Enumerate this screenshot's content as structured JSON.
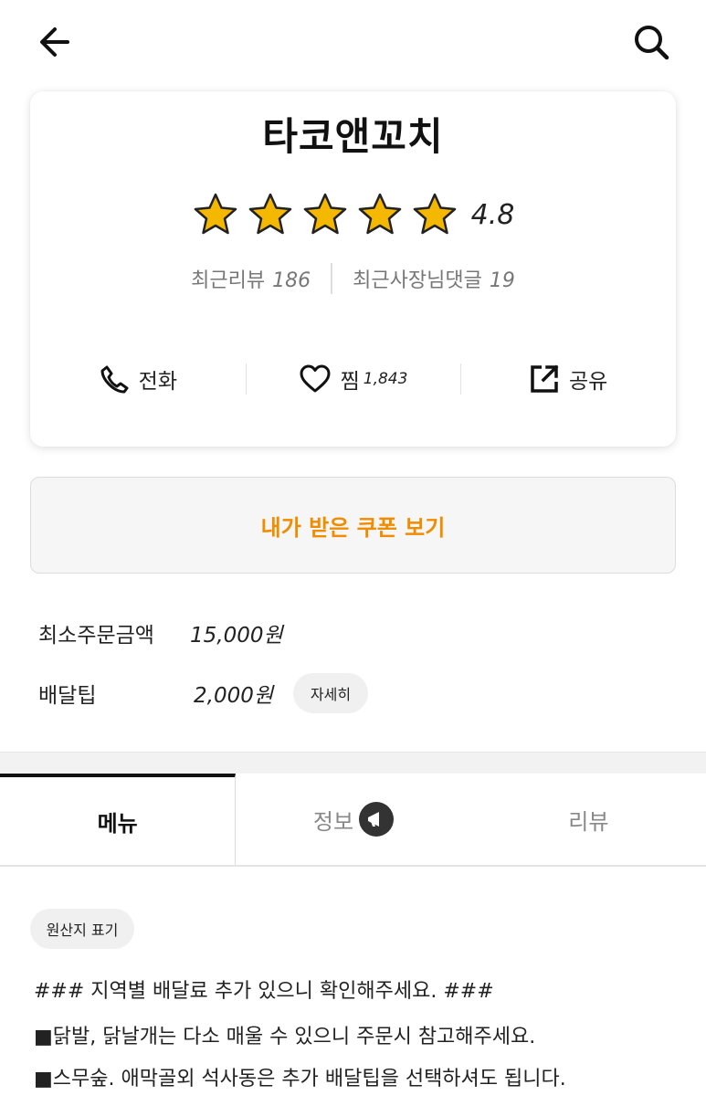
{
  "header": {
    "back_icon": "arrow-left-icon",
    "search_icon": "search-icon"
  },
  "store": {
    "name": "타코앤꼬치",
    "rating": "4.8",
    "stars_filled": 5,
    "star_color": "#f5b800",
    "recent_reviews_label": "최근리뷰",
    "recent_reviews_count": "186",
    "owner_replies_label": "최근사장님댓글",
    "owner_replies_count": "19"
  },
  "actions": {
    "call_label": "전화",
    "like_label": "찜",
    "like_count": "1,843",
    "share_label": "공유"
  },
  "coupon": {
    "label": "내가 받은 쿠폰 보기",
    "color": "#f08c00"
  },
  "order_info": {
    "min_order_label": "최소주문금액",
    "min_order_value": "15,000원",
    "delivery_tip_label": "배달팁",
    "delivery_tip_value": "2,000원",
    "detail_label": "자세히"
  },
  "tabs": [
    {
      "label": "메뉴",
      "active": true
    },
    {
      "label": "정보",
      "active": false
    },
    {
      "label": "리뷰",
      "active": false
    }
  ],
  "menu": {
    "origin_label": "원산지 표기",
    "notices": [
      "### 지역별 배달료 추가 있으니 확인해주세요. ###",
      "■닭발, 닭날개는 다소 매울 수 있으니 주문시 참고해주세요.",
      "■스무숲. 애막골외 석사동은 추가 배달팁을 선택하셔도 됩니다."
    ]
  }
}
